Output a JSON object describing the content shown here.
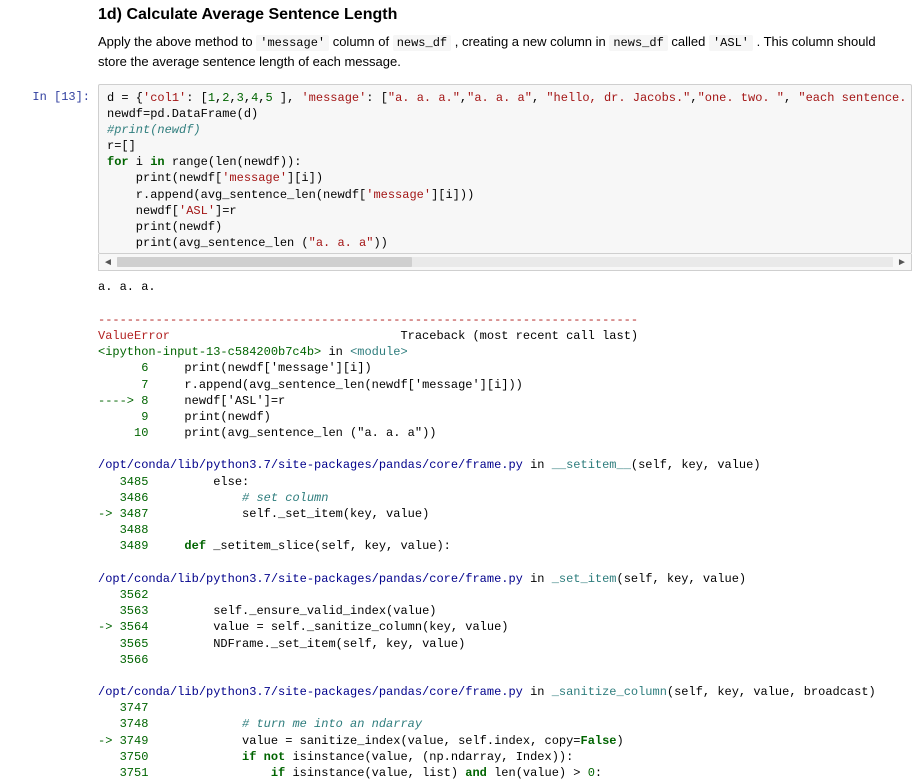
{
  "markdown": {
    "heading": "1d) Calculate Average Sentence Length",
    "para_before_code1": "Apply the above method to ",
    "code1": "'message'",
    "para_mid1": " column of ",
    "code2": "news_df",
    "para_mid2": " , creating a new column in ",
    "code3": "news_df",
    "para_mid3": " called ",
    "code4": "'ASL'",
    "para_after": " . This column should store the average sentence length of each message."
  },
  "cell": {
    "prompt": "In [13]:",
    "code": {
      "l1a": "d = {",
      "l1b": "'col1'",
      "l1c": ": [",
      "l1d": "1",
      "l1d2": ",",
      "l1e": "2",
      "l1e2": ",",
      "l1f": "3",
      "l1f2": ",",
      "l1g": "4",
      "l1g2": ",",
      "l1h": "5",
      "l1i": " ], ",
      "l1j": "'message'",
      "l1k": ": [",
      "l1s1": "\"a. a. a.\"",
      "l1sep1": ",",
      "l1s2": "\"a. a. a\"",
      "l1sep2": ", ",
      "l1s3": "\"hello, dr. Jacobs.\"",
      "l1sep3": ",",
      "l1s4": "\"one. two. \"",
      "l1sep4": ", ",
      "l1s5": "\"each sentence. has two. words r:",
      "l2": "newdf=pd.DataFrame(d)",
      "l3": "#print(newdf)",
      "l4": "r=[]",
      "l5a": "for",
      "l5b": " i ",
      "l5c": "in",
      "l5d": " range(len(newdf)):",
      "l6a": "    print(newdf[",
      "l6b": "'message'",
      "l6c": "][i])",
      "l7a": "    r.append(avg_sentence_len(newdf[",
      "l7b": "'message'",
      "l7c": "][i]))",
      "l8a": "    newdf[",
      "l8b": "'ASL'",
      "l8c": "]=r",
      "l9": "    print(newdf)",
      "l10a": "    print(avg_sentence_len (",
      "l10b": "\"a. a. a\"",
      "l10c": "))"
    }
  },
  "output": {
    "stdout": "a. a. a.",
    "dashes": "---------------------------------------------------------------------------",
    "err_name": "ValueError",
    "err_tail": "                                Traceback (most recent call last)",
    "tb1_file": "<ipython-input-13-c584200b7c4b>",
    "tb1_in": " in ",
    "tb1_mod": "<module>",
    "tb1_l6n": "      6",
    "tb1_l6": "     print(newdf['message'][i])",
    "tb1_l7n": "      7",
    "tb1_l7": "     r.append(avg_sentence_len(newdf['message'][i]))",
    "tb1_l8arrow": "----> 8",
    "tb1_l8": "     newdf['ASL']=r",
    "tb1_l9n": "      9",
    "tb1_l9": "     print(newdf)",
    "tb1_l10n": "     10",
    "tb1_l10": "     print(avg_sentence_len (\"a. a. a\"))",
    "tb2_path": "/opt/conda/lib/python3.7/site-packages/pandas/core/frame.py",
    "tb2_in": " in ",
    "tb2_func": "__setitem__",
    "tb2_sig": "(self, key, value)",
    "tb2_l3485n": "   3485",
    "tb2_l3485": "         else:",
    "tb2_l3486n": "   3486",
    "tb2_l3486": "             # set column",
    "tb2_l3487arrow": "-> 3487",
    "tb2_l3487": "             self._set_item(key, value)",
    "tb2_l3488n": "   3488",
    "tb2_l3488": "",
    "tb2_l3489n": "   3489",
    "tb2_l3489a": "     def",
    "tb2_l3489b": " _setitem_slice(self, key, value):",
    "tb3_path": "/opt/conda/lib/python3.7/site-packages/pandas/core/frame.py",
    "tb3_in": " in ",
    "tb3_func": "_set_item",
    "tb3_sig": "(self, key, value)",
    "tb3_l3562n": "   3562",
    "tb3_l3562": "",
    "tb3_l3563n": "   3563",
    "tb3_l3563": "         self._ensure_valid_index(value)",
    "tb3_l3564arrow": "-> 3564",
    "tb3_l3564": "         value = self._sanitize_column(key, value)",
    "tb3_l3565n": "   3565",
    "tb3_l3565": "         NDFrame._set_item(self, key, value)",
    "tb3_l3566n": "   3566",
    "tb3_l3566": "",
    "tb4_path": "/opt/conda/lib/python3.7/site-packages/pandas/core/frame.py",
    "tb4_in": " in ",
    "tb4_func": "_sanitize_column",
    "tb4_sig": "(self, key, value, broadcast)",
    "tb4_l3747n": "   3747",
    "tb4_l3747": "",
    "tb4_l3748n": "   3748",
    "tb4_l3748": "             # turn me into an ndarray",
    "tb4_l3749arrow": "-> 3749",
    "tb4_l3749a": "             value = sanitize_index(value, self.index, copy=",
    "tb4_l3749b": "False",
    "tb4_l3749c": ")",
    "tb4_l3750n": "   3750",
    "tb4_l3750a": "             if not",
    "tb4_l3750b": " isinstance(value, (np.ndarray, Index)):",
    "tb4_l3751n": "   3751",
    "tb4_l3751a": "                 if",
    "tb4_l3751b": " isinstance(value, list) ",
    "tb4_l3751c": "and",
    "tb4_l3751d": " len(value) > ",
    "tb4_l3751e": "0",
    "tb4_l3751f": ":"
  }
}
